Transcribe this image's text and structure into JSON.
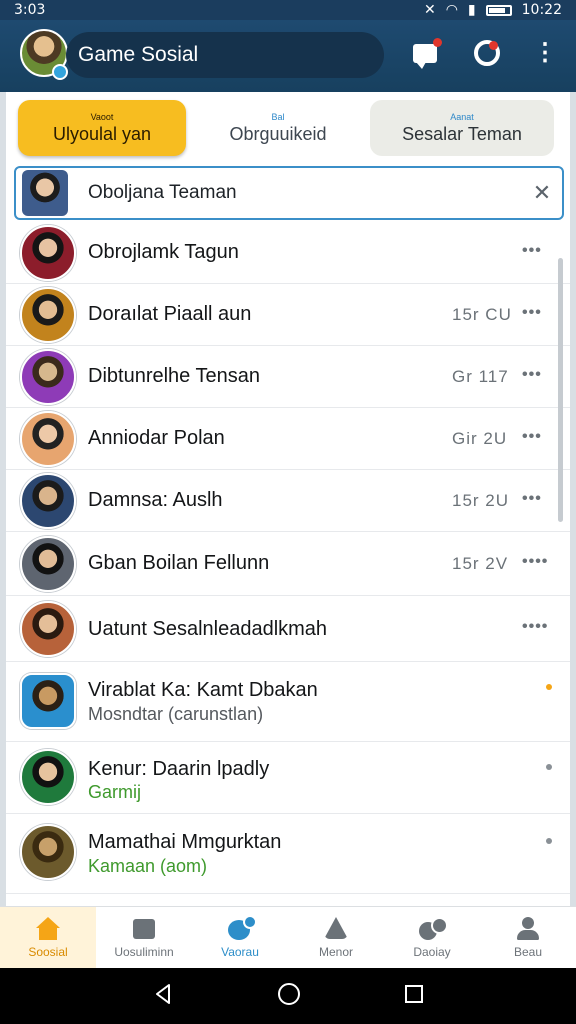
{
  "status_bar": {
    "time": "3:03",
    "clock_right": "10:22"
  },
  "header": {
    "title": "Game Sosial",
    "icons": [
      "avatar",
      "chat-icon",
      "notification-icon",
      "more-icon"
    ]
  },
  "tabs": [
    {
      "small": "Vaoot",
      "label": "Ulyoulal yan",
      "active": true
    },
    {
      "small": "Bal",
      "label": "Obrguuikeid",
      "active": false
    },
    {
      "small": "Aanat",
      "label": "Sesalar Teman",
      "active": false
    }
  ],
  "search": {
    "value": "Oboljana Teaman",
    "close": "✕"
  },
  "contacts": [
    {
      "name": "Obrojlamk Tagun",
      "time": "",
      "more": "•••"
    },
    {
      "name": "Doraılat Piaall aun",
      "time": "15r  CU",
      "more": "•••"
    },
    {
      "name": "Dibtunrelhe Tensan",
      "time": "Gr  117",
      "more": "•••"
    },
    {
      "name": "Anniodar Polan",
      "time": "Gir  2U",
      "more": "•••"
    },
    {
      "name": "Damnsa: Auslh",
      "time": "15r  2U",
      "more": "•••"
    },
    {
      "name": "Gban Boilan Fellunn",
      "time": "15r  2V",
      "more": "••••"
    },
    {
      "name": "Uatunt Sesalnleadadlkmah",
      "time": "",
      "more": "••••"
    },
    {
      "name": "Virablat Ka: Kamt Dbakan",
      "sub": "Mosndtar (carunstlan)",
      "sub_color": "#55595e",
      "dot_color": "#f5a516"
    },
    {
      "name": "Kenur: Daarin lpadly",
      "sub": "Garmij",
      "sub_color": "#3f9a2d",
      "dot_color": "#8a9096"
    },
    {
      "name": "Mamathai Mmgurktan",
      "sub": "Kamaan (aom)",
      "sub_color": "#3f9a2d",
      "dot_color": "#8a9096"
    }
  ],
  "bottom_nav": [
    {
      "label": "Soosial",
      "icon": "home-icon",
      "active": true
    },
    {
      "label": "Uosuliminn",
      "icon": "store-icon",
      "active": false
    },
    {
      "label": "Vaorau",
      "icon": "game-icon",
      "active": false
    },
    {
      "label": "Menor",
      "icon": "mentor-icon",
      "active": false
    },
    {
      "label": "Daoiay",
      "icon": "daily-icon",
      "active": false
    },
    {
      "label": "Beau",
      "icon": "user-icon",
      "active": false
    }
  ],
  "colors": {
    "header": "#1e4a70",
    "tab_active": "#f7bd20",
    "accent_blue": "#2d8ec9",
    "accent_green": "#3f9a2d"
  }
}
